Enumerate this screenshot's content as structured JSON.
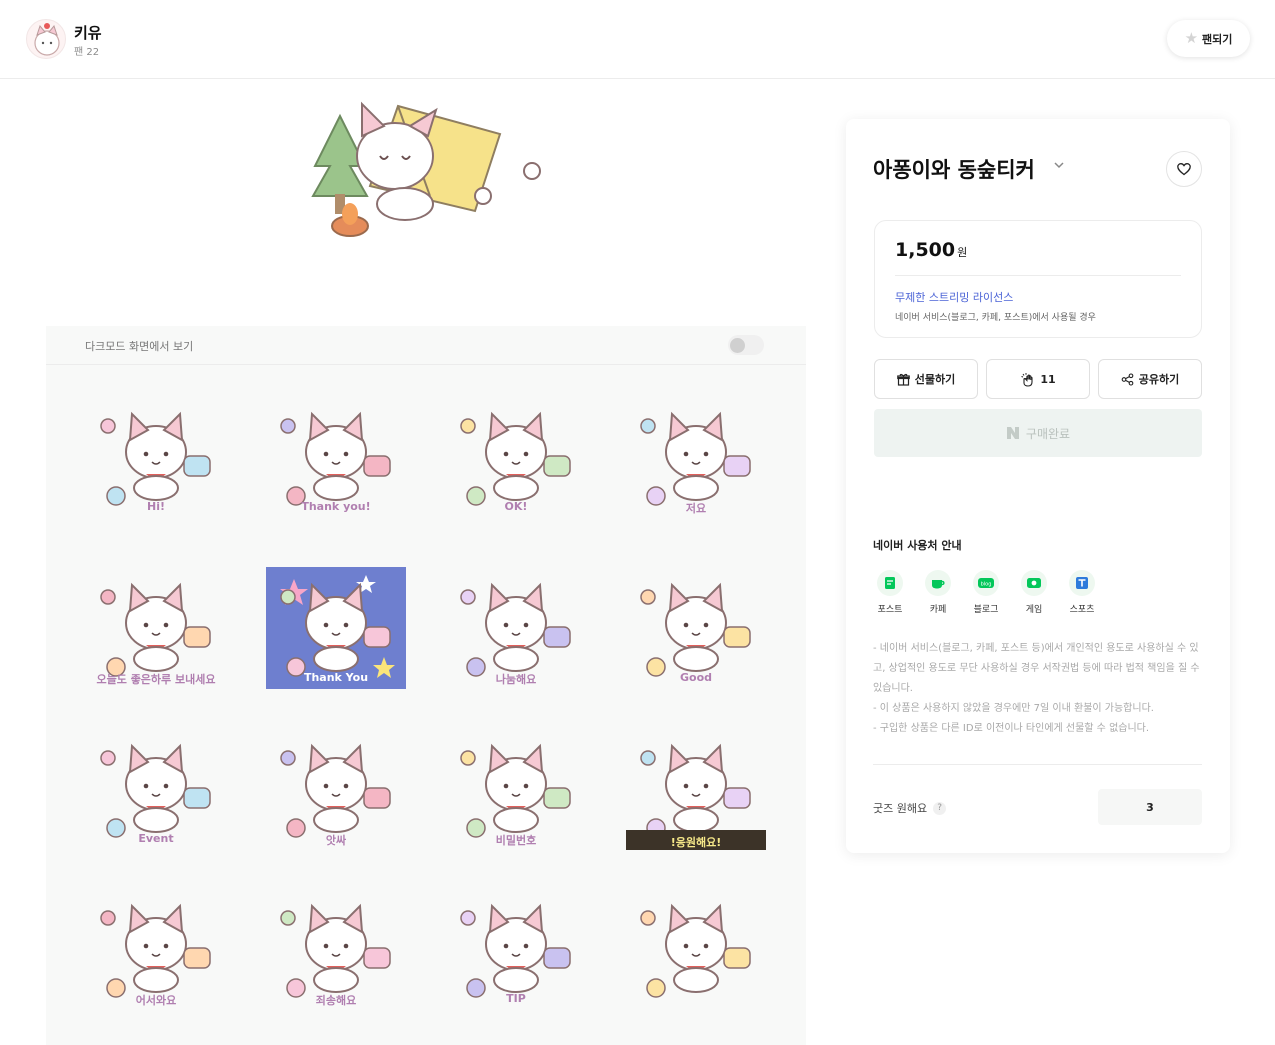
{
  "header": {
    "creator_name": "키유",
    "fan_count": "팬 22",
    "fan_button_label": "팬되기"
  },
  "preview": {
    "dark_mode_label": "다크모드 화면에서 보기",
    "dark_mode_on": false,
    "sticker_texts": [
      "Hi!",
      "Thank you!",
      "OK!",
      "저요",
      "오늘도 좋은하루 보내세요",
      "Thank You",
      "나눔해요",
      "Good",
      "Event",
      "앗싸",
      "비밀번호",
      "!응원해요!",
      "어서와요",
      "죄송해요",
      "TIP",
      ""
    ]
  },
  "product": {
    "title": "아퐁이와 동숲티커",
    "price": "1,500",
    "price_unit": "원",
    "license_link": "무제한 스트리밍 라이선스",
    "license_desc": "네이버 서비스(블로그, 카페, 포스트)에서 사용될 경우",
    "gift_label": "선물하기",
    "clap_count": "11",
    "share_label": "공유하기",
    "buy_label": "구매완료"
  },
  "usage": {
    "title": "네이버 사용처 안내",
    "items": [
      {
        "label": "포스트",
        "icon": "post-icon"
      },
      {
        "label": "카페",
        "icon": "cafe-icon"
      },
      {
        "label": "블로그",
        "icon": "blog-icon"
      },
      {
        "label": "게임",
        "icon": "game-icon"
      },
      {
        "label": "스포츠",
        "icon": "sports-icon"
      }
    ]
  },
  "notice": [
    "- 네이버 서비스(블로그, 카페, 포스트 등)에서 개인적인 용도로 사용하실 수 있고, 상업적인 용도로 무단 사용하실 경우 서작권법 등에 따라 법적 책임을 질 수 있습니다.",
    "- 이 상품은 사용하지 않았을 경우에만 7일 이내 환불이 가능합니다.",
    "- 구입한 상품은 다른 ID로 이전이나 타인에게 선물할 수 없습니다."
  ],
  "goods": {
    "label": "굿즈 원해요",
    "help": "?",
    "count": "3"
  },
  "colors": {
    "accent_blue": "#4b63d6",
    "naver_green": "#03c75a",
    "panel_bg": "#f8f9f8"
  }
}
